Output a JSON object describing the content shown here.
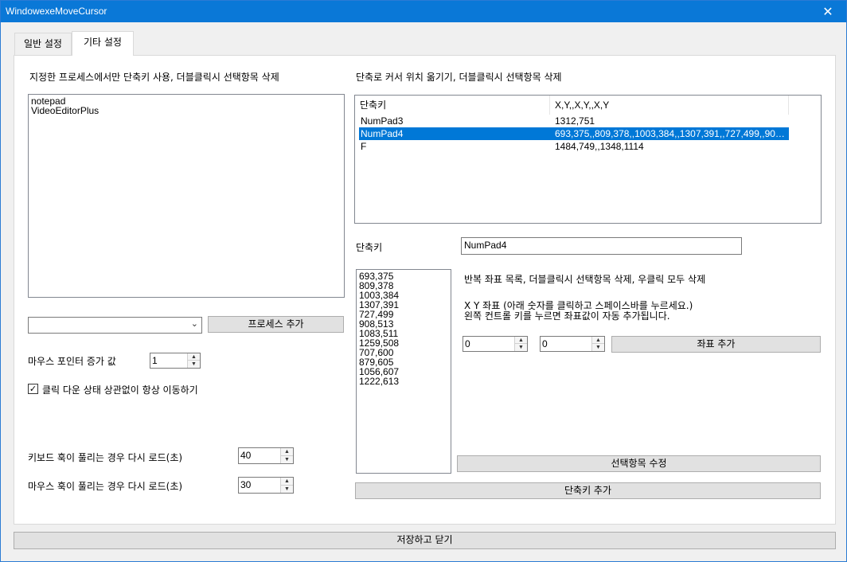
{
  "window": {
    "title": "WindowexeMoveCursor",
    "close_glyph": "✕"
  },
  "tabs": [
    {
      "label": "일반 설정"
    },
    {
      "label": "기타 설정"
    }
  ],
  "left": {
    "process_heading": "지정한 프로세스에서만 단축키 사용, 더블클릭시 선택항목 삭제",
    "process_list": [
      "notepad",
      "VideoEditorPlus"
    ],
    "combo_value": "",
    "add_process_button": "프로세스 추가",
    "mouse_pointer_label": "마우스 포인터 증가 값",
    "mouse_pointer_value": "1",
    "checkbox_label": "클릭 다운 상태 상관없이 항상 이동하기",
    "checkbox_checked": true,
    "keyboard_reload_label": "키보드 훅이 풀리는 경우 다시 로드(초)",
    "keyboard_reload_value": "40",
    "mouse_reload_label": "마우스 훅이 풀리는 경우 다시 로드(초)",
    "mouse_reload_value": "30"
  },
  "right": {
    "shortcut_heading": "단축로 커서 위치 옮기기, 더블클릭시 선택항목 삭제",
    "listview": {
      "columns": [
        "단축키",
        "X,Y,,X,Y,,X,Y"
      ],
      "rows": [
        {
          "key": "NumPad3",
          "coords": "1312,751",
          "selected": false
        },
        {
          "key": "NumPad4",
          "coords": "693,375,,809,378,,1003,384,,1307,391,,727,499,,908,...",
          "selected": true
        },
        {
          "key": "F",
          "coords": "1484,749,,1348,1114",
          "selected": false
        }
      ]
    },
    "shortcut_label": "단축키",
    "shortcut_value": "NumPad4",
    "coord_list": [
      "693,375",
      "809,378",
      "1003,384",
      "1307,391",
      "727,499",
      "908,513",
      "1083,511",
      "1259,508",
      "707,600",
      "879,605",
      "1056,607",
      "1222,613"
    ],
    "repeat_info": "반복 좌표 목록, 더블클릭시 선택항목 삭제, 우클릭 모두 삭제",
    "xy_info_line1": "X Y 좌표 (아래 숫자를 클릭하고 스페이스바를 누르세요.)",
    "xy_info_line2": "왼쪽 컨트롤 키를 누르면 좌표값이 자동 추가됩니다.",
    "x_value": "0",
    "y_value": "0",
    "add_coord_button": "좌표 추가",
    "edit_selected_button": "선택항목 수정",
    "add_shortcut_button": "단축키 추가"
  },
  "footer": {
    "save_close_button": "저장하고 닫기"
  }
}
